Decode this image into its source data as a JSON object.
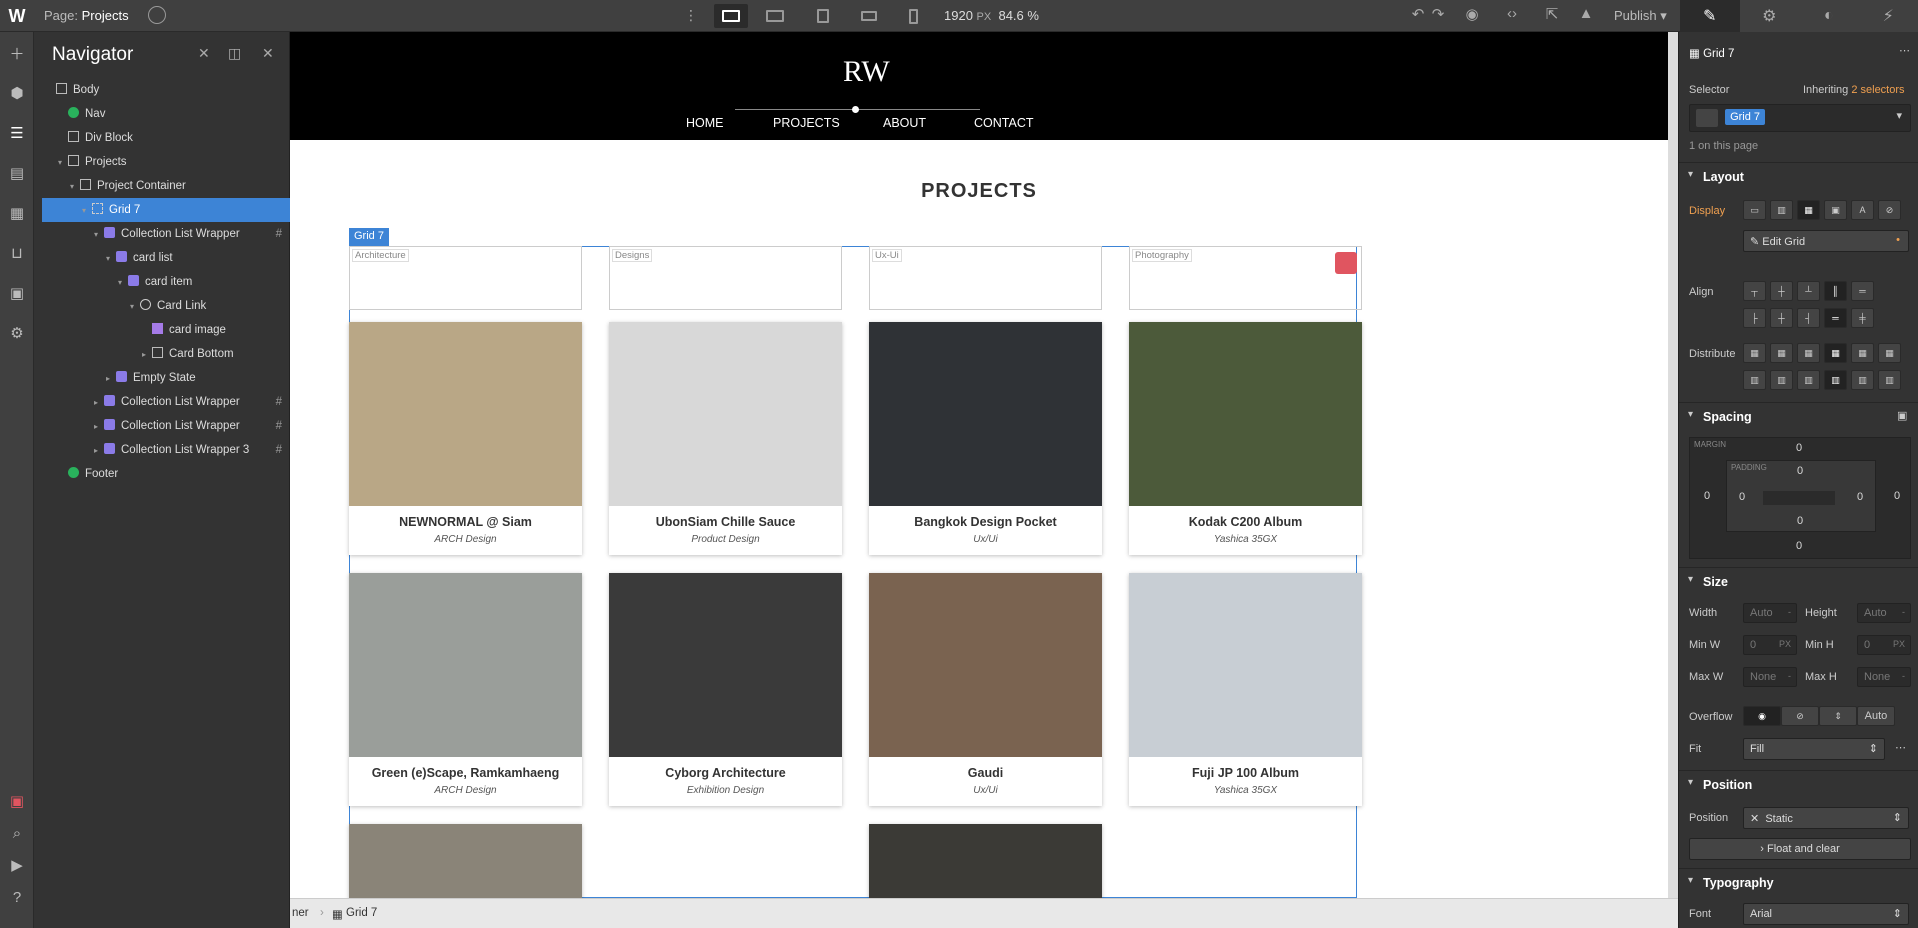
{
  "topbar": {
    "logo": "W",
    "page_label": "Page:",
    "page_name": "Projects",
    "viewport_width": "1920",
    "viewport_unit": "PX",
    "zoom": "84.6 %",
    "publish_label": "Publish"
  },
  "navigator": {
    "title": "Navigator",
    "items": [
      {
        "label": "Body",
        "depth": 0,
        "icon": "box-icon"
      },
      {
        "label": "Nav",
        "depth": 1,
        "icon": "symbol-icon"
      },
      {
        "label": "Div Block",
        "depth": 1,
        "icon": "box-icon"
      },
      {
        "label": "Projects",
        "depth": 1,
        "icon": "box-icon"
      },
      {
        "label": "Project Container",
        "depth": 2,
        "icon": "container-icon"
      },
      {
        "label": "Grid 7",
        "depth": 3,
        "icon": "grid-icon"
      },
      {
        "label": "Collection List Wrapper",
        "depth": 4,
        "icon": "collection-icon"
      },
      {
        "label": "card list",
        "depth": 5,
        "icon": "collection-icon"
      },
      {
        "label": "card item",
        "depth": 6,
        "icon": "collection-icon"
      },
      {
        "label": "Card Link",
        "depth": 7,
        "icon": "link-icon"
      },
      {
        "label": "card image",
        "depth": 8,
        "icon": "image-icon"
      },
      {
        "label": "Card Bottom",
        "depth": 8,
        "icon": "box-icon"
      },
      {
        "label": "Empty State",
        "depth": 5,
        "icon": "collection-icon"
      },
      {
        "label": "Collection List Wrapper",
        "depth": 4,
        "icon": "collection-icon"
      },
      {
        "label": "Collection List Wrapper",
        "depth": 4,
        "icon": "collection-icon"
      },
      {
        "label": "Collection List Wrapper 3",
        "depth": 4,
        "icon": "collection-icon"
      },
      {
        "label": "Footer",
        "depth": 1,
        "icon": "symbol-icon"
      }
    ]
  },
  "site": {
    "logo": "RW",
    "nav_links": [
      "HOME",
      "PROJECTS",
      "ABOUT",
      "CONTACT"
    ],
    "page_title": "PROJECTS",
    "grid_tag": "Grid 7",
    "filters": [
      "Architecture",
      "Designs",
      "Ux-Ui",
      "Photography"
    ],
    "cards": [
      {
        "title": "NEWNORMAL @ Siam",
        "subtitle": "ARCH Design",
        "color": "#b9a786"
      },
      {
        "title": "UbonSiam Chille Sauce",
        "subtitle": "Product Design",
        "color": "#d8d8d8"
      },
      {
        "title": "Bangkok Design Pocket",
        "subtitle": "Ux/Ui",
        "color": "#2f3236"
      },
      {
        "title": "Kodak C200 Album",
        "subtitle": "Yashica 35GX",
        "color": "#4c5a3a"
      },
      {
        "title": "Green (e)Scape, Ramkamhaeng",
        "subtitle": "ARCH Design",
        "color": "#9a9e9a"
      },
      {
        "title": "Cyborg Architecture",
        "subtitle": "Exhibition Design",
        "color": "#3a3a3a"
      },
      {
        "title": "Gaudi",
        "subtitle": "Ux/Ui",
        "color": "#7a6350"
      },
      {
        "title": "Fuji JP 100 Album",
        "subtitle": "Yashica 35GX",
        "color": "#c8ced4"
      }
    ]
  },
  "breadcrumbs": [
    "ner",
    "Grid 7"
  ],
  "style_panel": {
    "element_name": "Grid 7",
    "selector_label": "Selector",
    "inheriting_label": "Inheriting",
    "inheriting_count": "2 selectors",
    "selector_value": "Grid 7",
    "on_page": "1 on this page",
    "layout": {
      "heading": "Layout",
      "display_label": "Display",
      "edit_grid": "Edit Grid",
      "align_label": "Align",
      "distribute_label": "Distribute"
    },
    "spacing": {
      "heading": "Spacing",
      "margin_label": "MARGIN",
      "padding_label": "PADDING",
      "margin": {
        "top": "0",
        "right": "0",
        "bottom": "0",
        "left": "0"
      },
      "padding": {
        "top": "0",
        "right": "0",
        "bottom": "0",
        "left": "0"
      }
    },
    "size": {
      "heading": "Size",
      "width_label": "Width",
      "width": "Auto",
      "height_label": "Height",
      "height": "Auto",
      "minw_label": "Min W",
      "minw": "0",
      "minh_label": "Min H",
      "minh": "0",
      "maxw_label": "Max W",
      "maxw": "None",
      "maxh_label": "Max H",
      "maxh": "None",
      "unit": "PX",
      "dash": "-",
      "overflow_label": "Overflow",
      "overflow_auto": "Auto",
      "fit_label": "Fit",
      "fit_value": "Fill"
    },
    "position": {
      "heading": "Position",
      "position_label": "Position",
      "position_value": "Static",
      "float_clear": "Float and clear"
    },
    "typography": {
      "heading": "Typography",
      "font_label": "Font",
      "font_value": "Arial"
    }
  },
  "colors": {
    "accent": "#3d84d6",
    "orange": "#f0a050",
    "badge": "#e05560"
  }
}
